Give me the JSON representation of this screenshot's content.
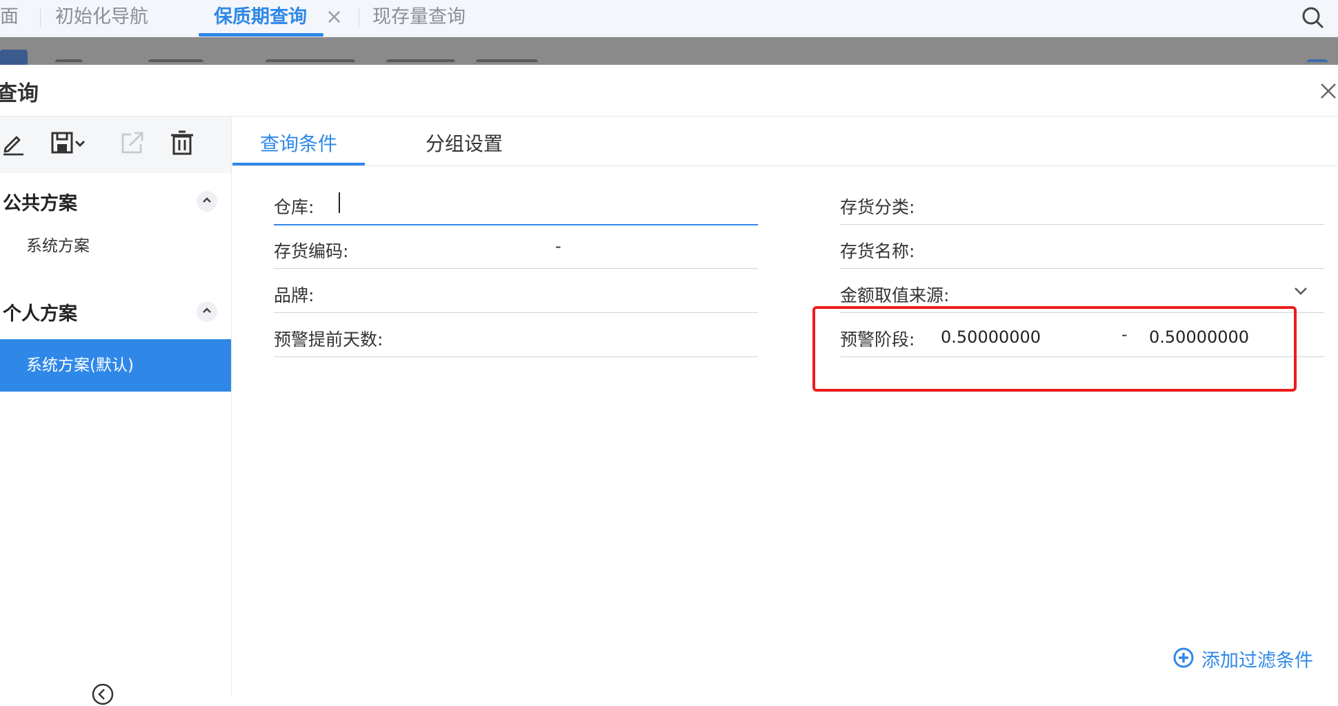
{
  "tabbar": {
    "tabs": [
      {
        "label": "面"
      },
      {
        "label": "初始化导航"
      },
      {
        "label": "保质期查询",
        "active": true,
        "closable": true
      },
      {
        "label": "现存量查询"
      }
    ],
    "close_glyph": "×"
  },
  "dialog": {
    "title": "查询",
    "left_pane": {
      "toolbar_icons": [
        "edit-icon",
        "save-icon",
        "export-icon",
        "delete-icon"
      ],
      "sections": [
        {
          "label": "公共方案",
          "items": [
            {
              "label": "系统方案"
            }
          ]
        },
        {
          "label": "个人方案",
          "items": [
            {
              "label": "系统方案(默认)",
              "selected": true
            }
          ]
        }
      ]
    },
    "right_pane": {
      "tabs": [
        {
          "label": "查询条件",
          "active": true
        },
        {
          "label": "分组设置"
        }
      ],
      "fields": {
        "warehouse": {
          "label": "仓库:",
          "value": ""
        },
        "inventory_category": {
          "label": "存货分类:",
          "value": ""
        },
        "inventory_code": {
          "label": "存货编码:",
          "range_separator": "-"
        },
        "inventory_name": {
          "label": "存货名称:",
          "value": ""
        },
        "brand": {
          "label": "品牌:",
          "value": ""
        },
        "amount_source": {
          "label": "金额取值来源:",
          "value": ""
        },
        "warning_days": {
          "label": "预警提前天数:",
          "value": ""
        },
        "warning_stage": {
          "label": "预警阶段:",
          "from": "0.50000000",
          "range_separator": "-",
          "to": "0.50000000"
        }
      },
      "add_filter_label": "添加过滤条件"
    }
  },
  "colors": {
    "accent": "#2f88e8",
    "highlight": "#ec1c1c",
    "overlay": "#8a8a8a"
  }
}
